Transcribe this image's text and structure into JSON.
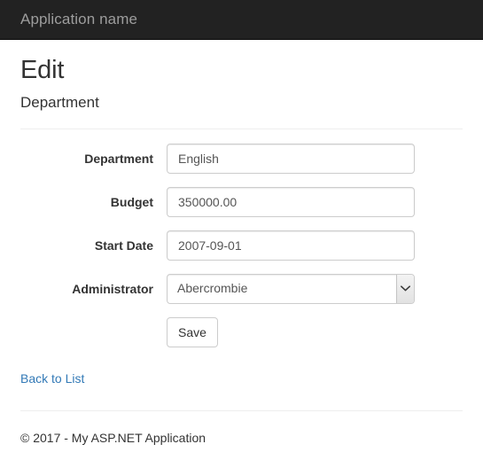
{
  "navbar": {
    "brand": "Application name"
  },
  "page": {
    "title": "Edit",
    "subtitle": "Department"
  },
  "form": {
    "fields": [
      {
        "label": "Department",
        "value": "English",
        "type": "text"
      },
      {
        "label": "Budget",
        "value": "350000.00",
        "type": "text"
      },
      {
        "label": "Start Date",
        "value": "2007-09-01",
        "type": "text"
      },
      {
        "label": "Administrator",
        "value": "Abercrombie",
        "type": "select"
      }
    ],
    "save_label": "Save"
  },
  "links": {
    "back_to_list": "Back to List"
  },
  "footer": {
    "copyright": "© 2017 - My ASP.NET Application"
  },
  "icons": {
    "chevron_down": "chevron-down-icon"
  },
  "colors": {
    "navbar_bg": "#222222",
    "navbar_text": "#9d9d9d",
    "link": "#337ab7",
    "input_border": "#cccccc",
    "text": "#333333",
    "input_text": "#555555",
    "divider": "#eeeeee"
  }
}
